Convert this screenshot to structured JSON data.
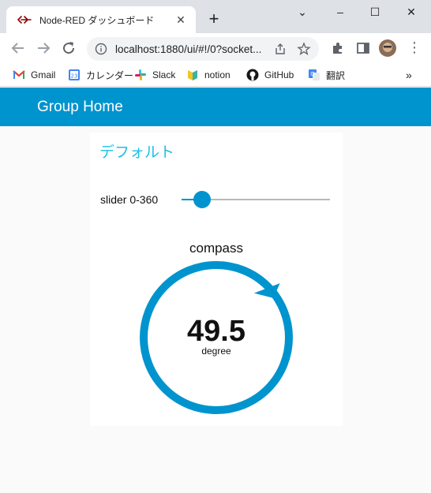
{
  "browser": {
    "tab_title": "Node-RED ダッシュボード",
    "url": "localhost:1880/ui/#!/0?socket..."
  },
  "bookmarks": [
    {
      "label": "Gmail"
    },
    {
      "label": "カレンダー"
    },
    {
      "label": "Slack"
    },
    {
      "label": "notion"
    },
    {
      "label": "GitHub"
    },
    {
      "label": "翻訳"
    }
  ],
  "dashboard": {
    "header_title": "Group Home",
    "group_title": "デフォルト",
    "slider": {
      "label": "slider 0-360",
      "min": 0,
      "max": 360,
      "value": 49.5
    },
    "gauge": {
      "title": "compass",
      "value": "49.5",
      "units": "degree",
      "color": "#0094ce"
    }
  },
  "colors": {
    "accent": "#0094ce",
    "group_title": "#1bbfe8"
  }
}
